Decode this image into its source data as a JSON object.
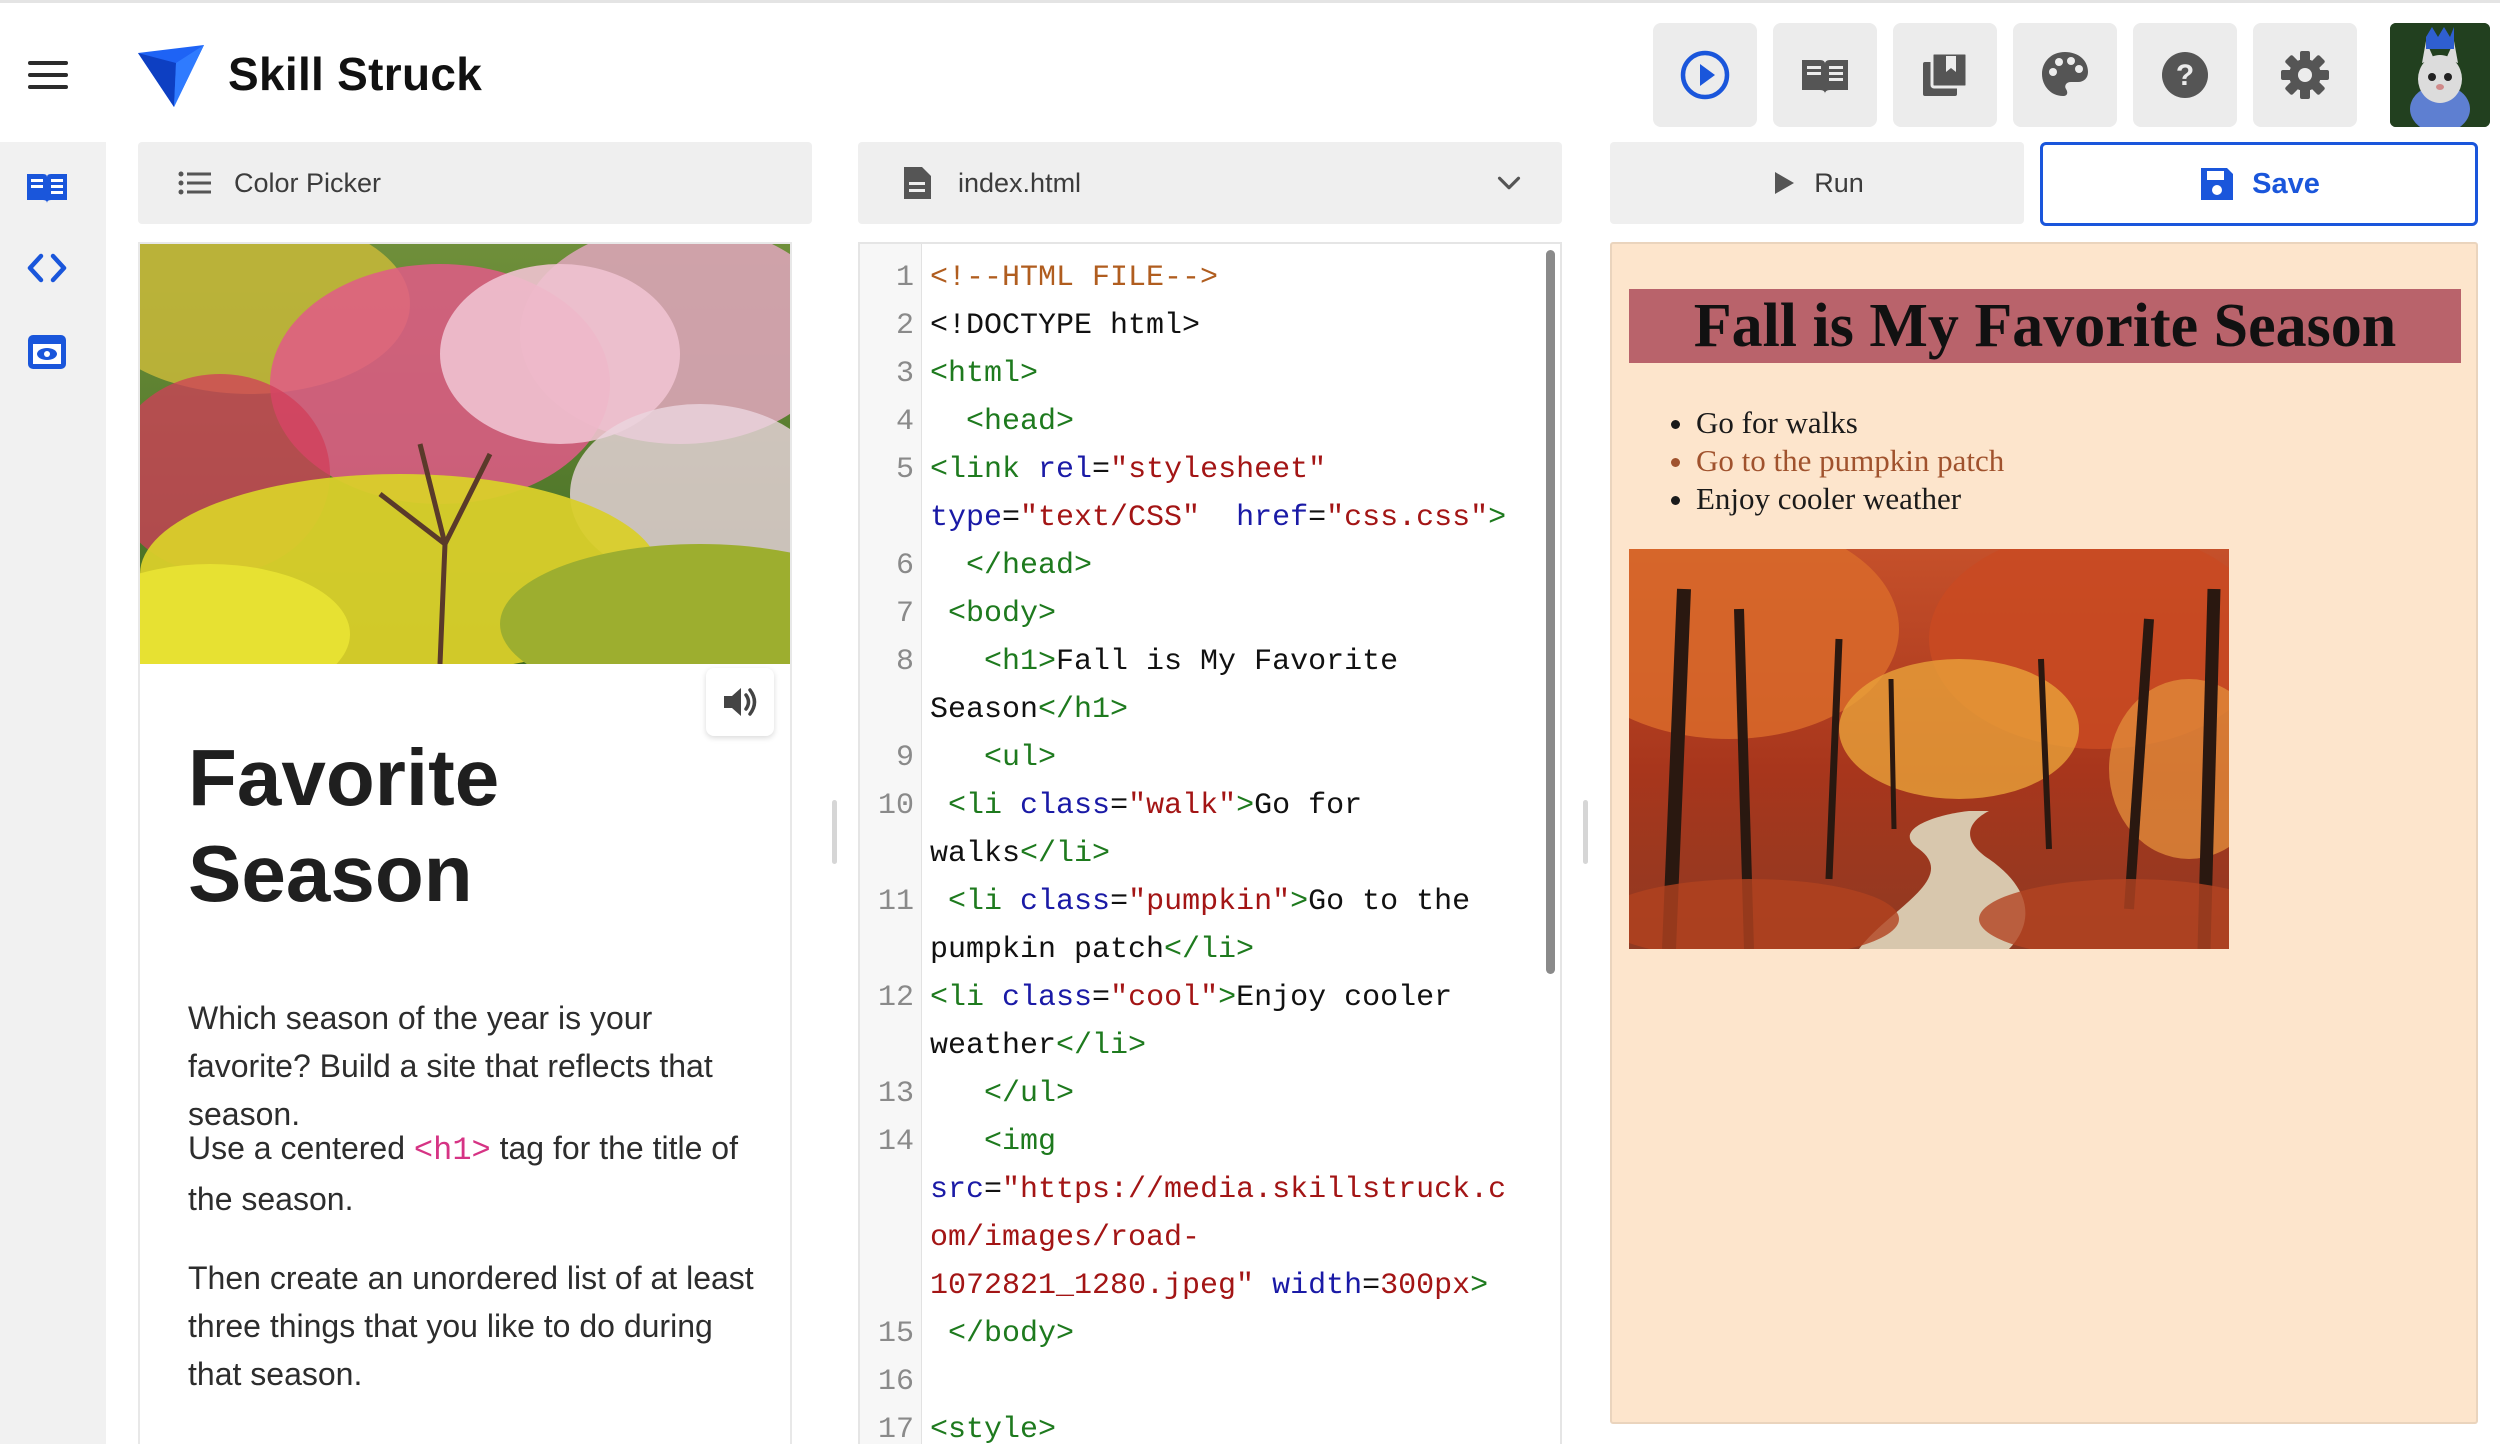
{
  "app": {
    "name": "Skill Struck"
  },
  "toolbar": {
    "buttons": [
      "play-circle-icon",
      "lesson-book-icon",
      "library-icon",
      "palette-icon",
      "help-icon",
      "settings-icon"
    ]
  },
  "sidebar": {
    "items": [
      "lesson-icon",
      "code-icon",
      "preview-icon"
    ]
  },
  "panels": {
    "lesson_header": "Color Picker",
    "file_header": "index.html",
    "run_label": "Run",
    "save_label": "Save"
  },
  "lesson": {
    "title": "Favorite Season",
    "para1": "Which season of the year is your favorite? Build a site that reflects that season.",
    "para2_before": "Use a centered ",
    "para2_tag": "<h1>",
    "para2_after": " tag for the title of the season.",
    "para3": "Then create an unordered list of at least three things that you like to do during that season."
  },
  "code": {
    "l1": "<!--HTML FILE-->",
    "l2": "<!DOCTYPE html>",
    "l3": "<html>",
    "l4": "<head>",
    "l5a_tag": "<link",
    "l5a_attr": "rel",
    "l5a_val": "\"stylesheet\"",
    "l5b_attr1": "type",
    "l5b_val1": "\"text/CSS\"",
    "l5b_attr2": "href",
    "l5b_val2": "\"css.css\"",
    "l6": "</head>",
    "l7": "<body>",
    "l8a_tag": "<h1>",
    "l8a_text": "Fall is My Favorite",
    "l8b_text": "Season",
    "l8b_tag": "</h1>",
    "l9": "<ul>",
    "l10_attrval": "\"walk\"",
    "l10_text": "Go for",
    "l10b_text": "walks",
    "l11_attrval": "\"pumpkin\"",
    "l11_text": "Go to the",
    "l11b_text": "pumpkin patch",
    "l12_attrval": "\"cool\"",
    "l12_text": "Enjoy cooler",
    "l12b_text": "weather",
    "li_open": "<li",
    "li_class": "class",
    "li_close": "</li>",
    "l13": "</ul>",
    "l14": "<img",
    "l14b_attr": "src",
    "l14b_val": "\"https://media.skillstruck.c",
    "l14c_val": "om/images/road-",
    "l14d_val": "1072821_1280.jpeg\"",
    "l14d_attr": "width",
    "l14d_num": "300px",
    "l15": "</body>",
    "l17": "<style>"
  },
  "preview": {
    "title": "Fall is My Favorite Season",
    "items": [
      "Go for walks",
      "Go to the pumpkin patch",
      "Enjoy cooler weather"
    ],
    "bg_color": "#fde5cc",
    "title_bg": "#b9636b",
    "pumpkin_color": "#a0522d"
  },
  "colors": {
    "accent": "#1a56db",
    "code_attr": "#1a1aa6",
    "code_string": "#a31515",
    "code_tag": "#1e7a1e",
    "code_comment": "#b05d1f"
  }
}
